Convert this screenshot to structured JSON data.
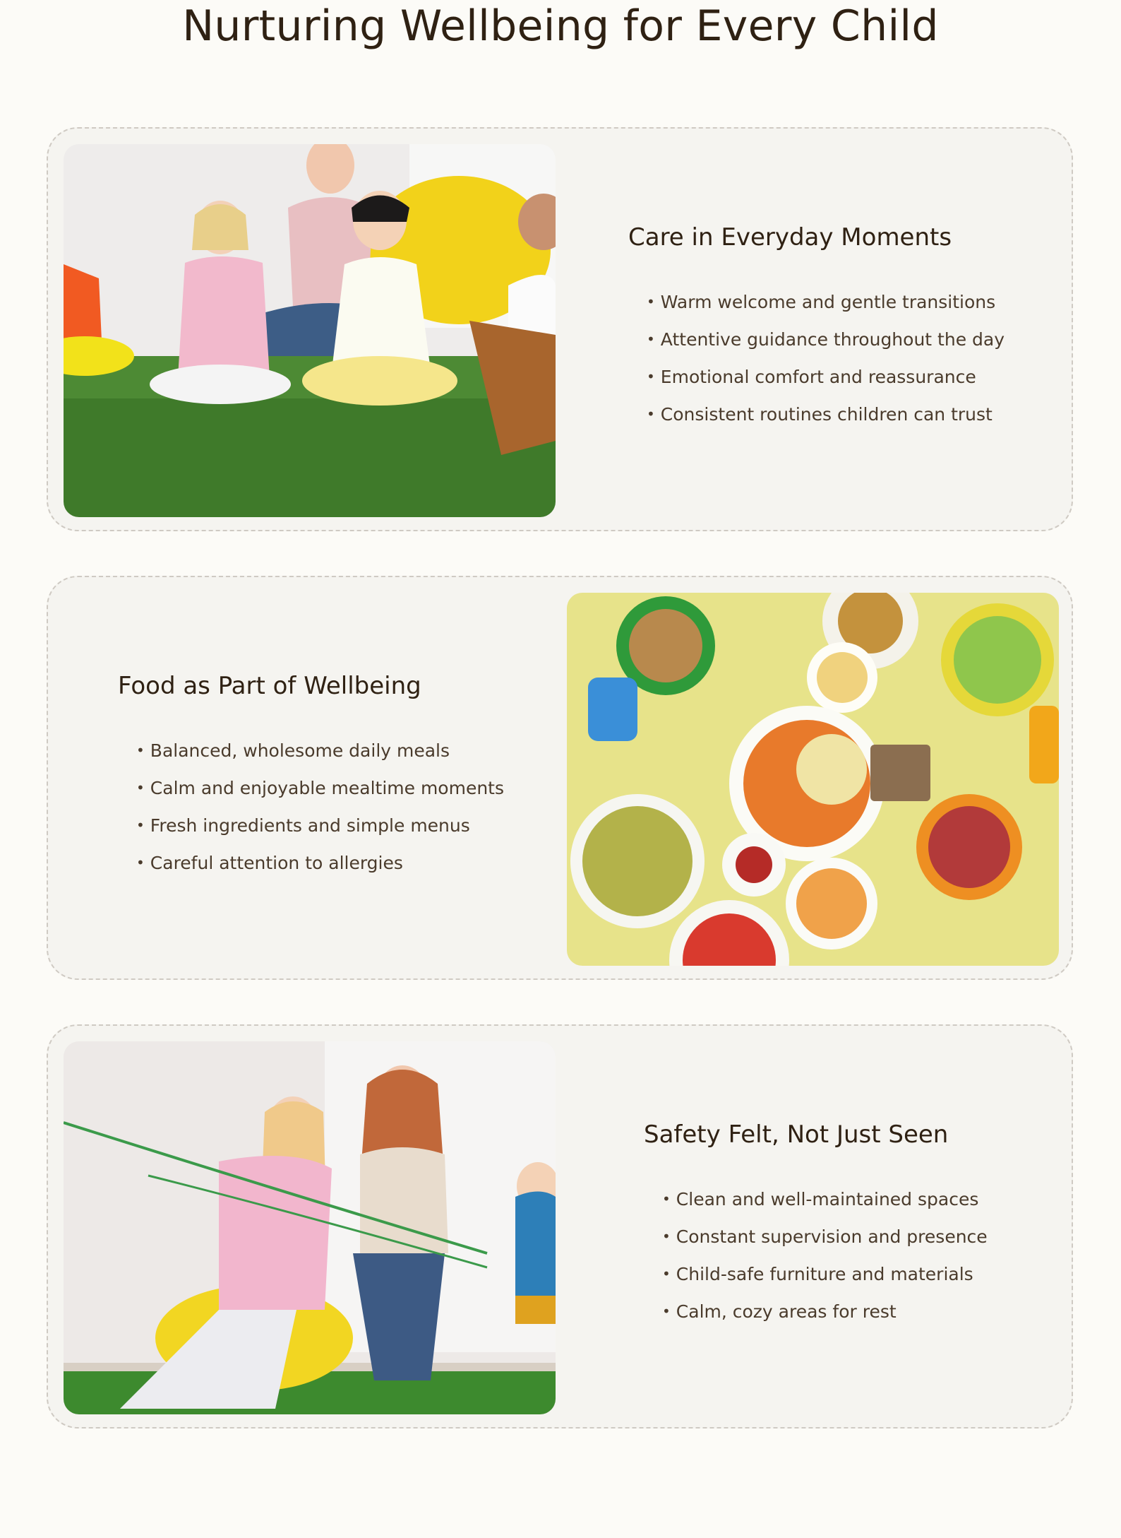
{
  "page": {
    "title": "Nurturing Wellbeing for Every Child"
  },
  "sections": [
    {
      "heading": "Care in Everyday Moments",
      "image_alt": "Children sitting on green carpet with a teacher",
      "items": [
        "Warm welcome and gentle transitions",
        "Attentive guidance throughout the day",
        "Emotional comfort and reassurance",
        "Consistent routines children can trust"
      ]
    },
    {
      "heading": "Food as Part of Wellbeing",
      "image_alt": "Table with healthy food bowls and children's hands",
      "items": [
        "Balanced, wholesome daily meals",
        "Calm and enjoyable mealtime moments",
        "Fresh ingredients and simple menus",
        "Careful attention to allergies"
      ]
    },
    {
      "heading": "Safety Felt, Not Just Seen",
      "image_alt": "Teacher and children playing tug of war",
      "items": [
        "Clean and well-maintained spaces",
        "Constant supervision and presence",
        "Child-safe furniture and materials",
        "Calm, cozy areas for rest"
      ]
    }
  ]
}
